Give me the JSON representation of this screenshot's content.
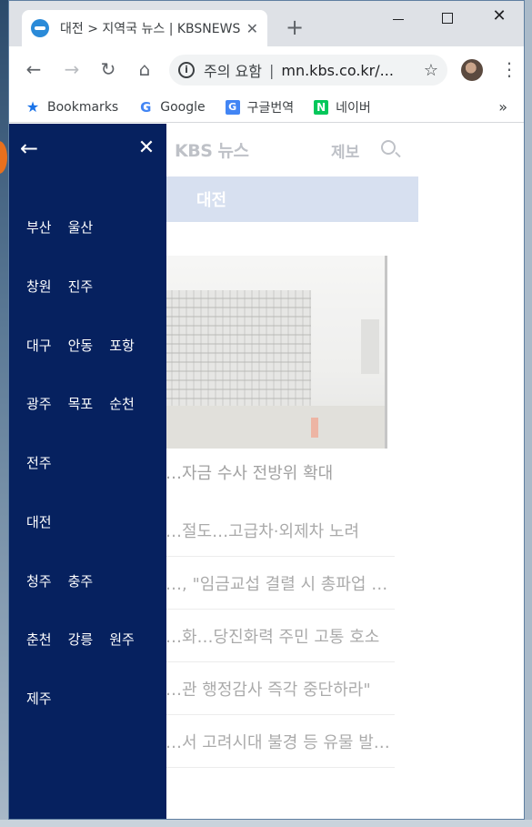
{
  "browser": {
    "tab": {
      "title": "대전 > 지역국 뉴스 | KBSNEWS",
      "close_glyph": "✕"
    },
    "new_tab_glyph": "+",
    "window_controls": {
      "close_glyph": "✕"
    },
    "omnibox": {
      "info_glyph": "i",
      "warning": "주의 요함",
      "separator": "|",
      "url": "mn.kbs.co.kr/...",
      "star_glyph": "☆"
    },
    "nav": {
      "back": "←",
      "forward": "→",
      "reload": "↻",
      "home": "⌂"
    },
    "menu_glyph": "⋮",
    "bookmarks": [
      {
        "label": "Bookmarks",
        "icon": "star-icon",
        "glyph": "★"
      },
      {
        "label": "Google",
        "icon": "google-icon",
        "glyph": "G"
      },
      {
        "label": "구글번역",
        "icon": "translate-icon",
        "glyph": "G"
      },
      {
        "label": "네이버",
        "icon": "naver-icon",
        "glyph": "N"
      }
    ],
    "bookmarks_more": "»"
  },
  "page": {
    "logo": "KBS 뉴스",
    "report_label": "제보",
    "region_title": "대전",
    "headline": "…자금 수사 전방위 확대",
    "news": [
      "…절도…고급차·외제차 노려",
      "…, \"임금교섭 결렬 시 총파업 …",
      "…화…당진화력 주민 고통 호소",
      "…관 행정감사 즉각 중단하라\"",
      "…서 고려시대 불경 등 유물 발…"
    ]
  },
  "drawer": {
    "back_glyph": "←",
    "close_glyph": "✕",
    "rows": [
      [
        "부산",
        "울산"
      ],
      [
        "창원",
        "진주"
      ],
      [
        "대구",
        "안동",
        "포항"
      ],
      [
        "광주",
        "목포",
        "순천"
      ],
      [
        "전주"
      ],
      [
        "대전"
      ],
      [
        "청주",
        "충주"
      ],
      [
        "춘천",
        "강릉",
        "원주"
      ],
      [
        "제주"
      ]
    ]
  },
  "colors": {
    "drawer_bg": "#06215f",
    "region_bar": "#b7c7e4",
    "tab_strip": "#dee1e6"
  }
}
